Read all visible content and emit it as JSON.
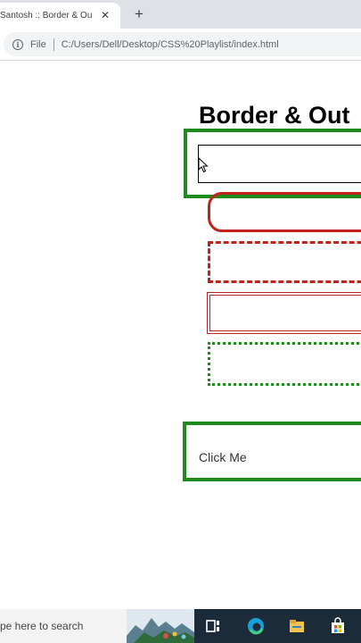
{
  "browser": {
    "tab_title": "Santosh :: Border & Ou",
    "tab_close": "✕",
    "new_tab": "+",
    "security_label": "File",
    "url": "C:/Users/Dell/Desktop/CSS%20Playlist/index.html"
  },
  "page": {
    "heading": "Border & Out",
    "button_label": "Click Me"
  },
  "colors": {
    "green_border": "#1e8a1e",
    "red_border": "#c0231b"
  },
  "taskbar": {
    "search_text": "pe here to search"
  }
}
